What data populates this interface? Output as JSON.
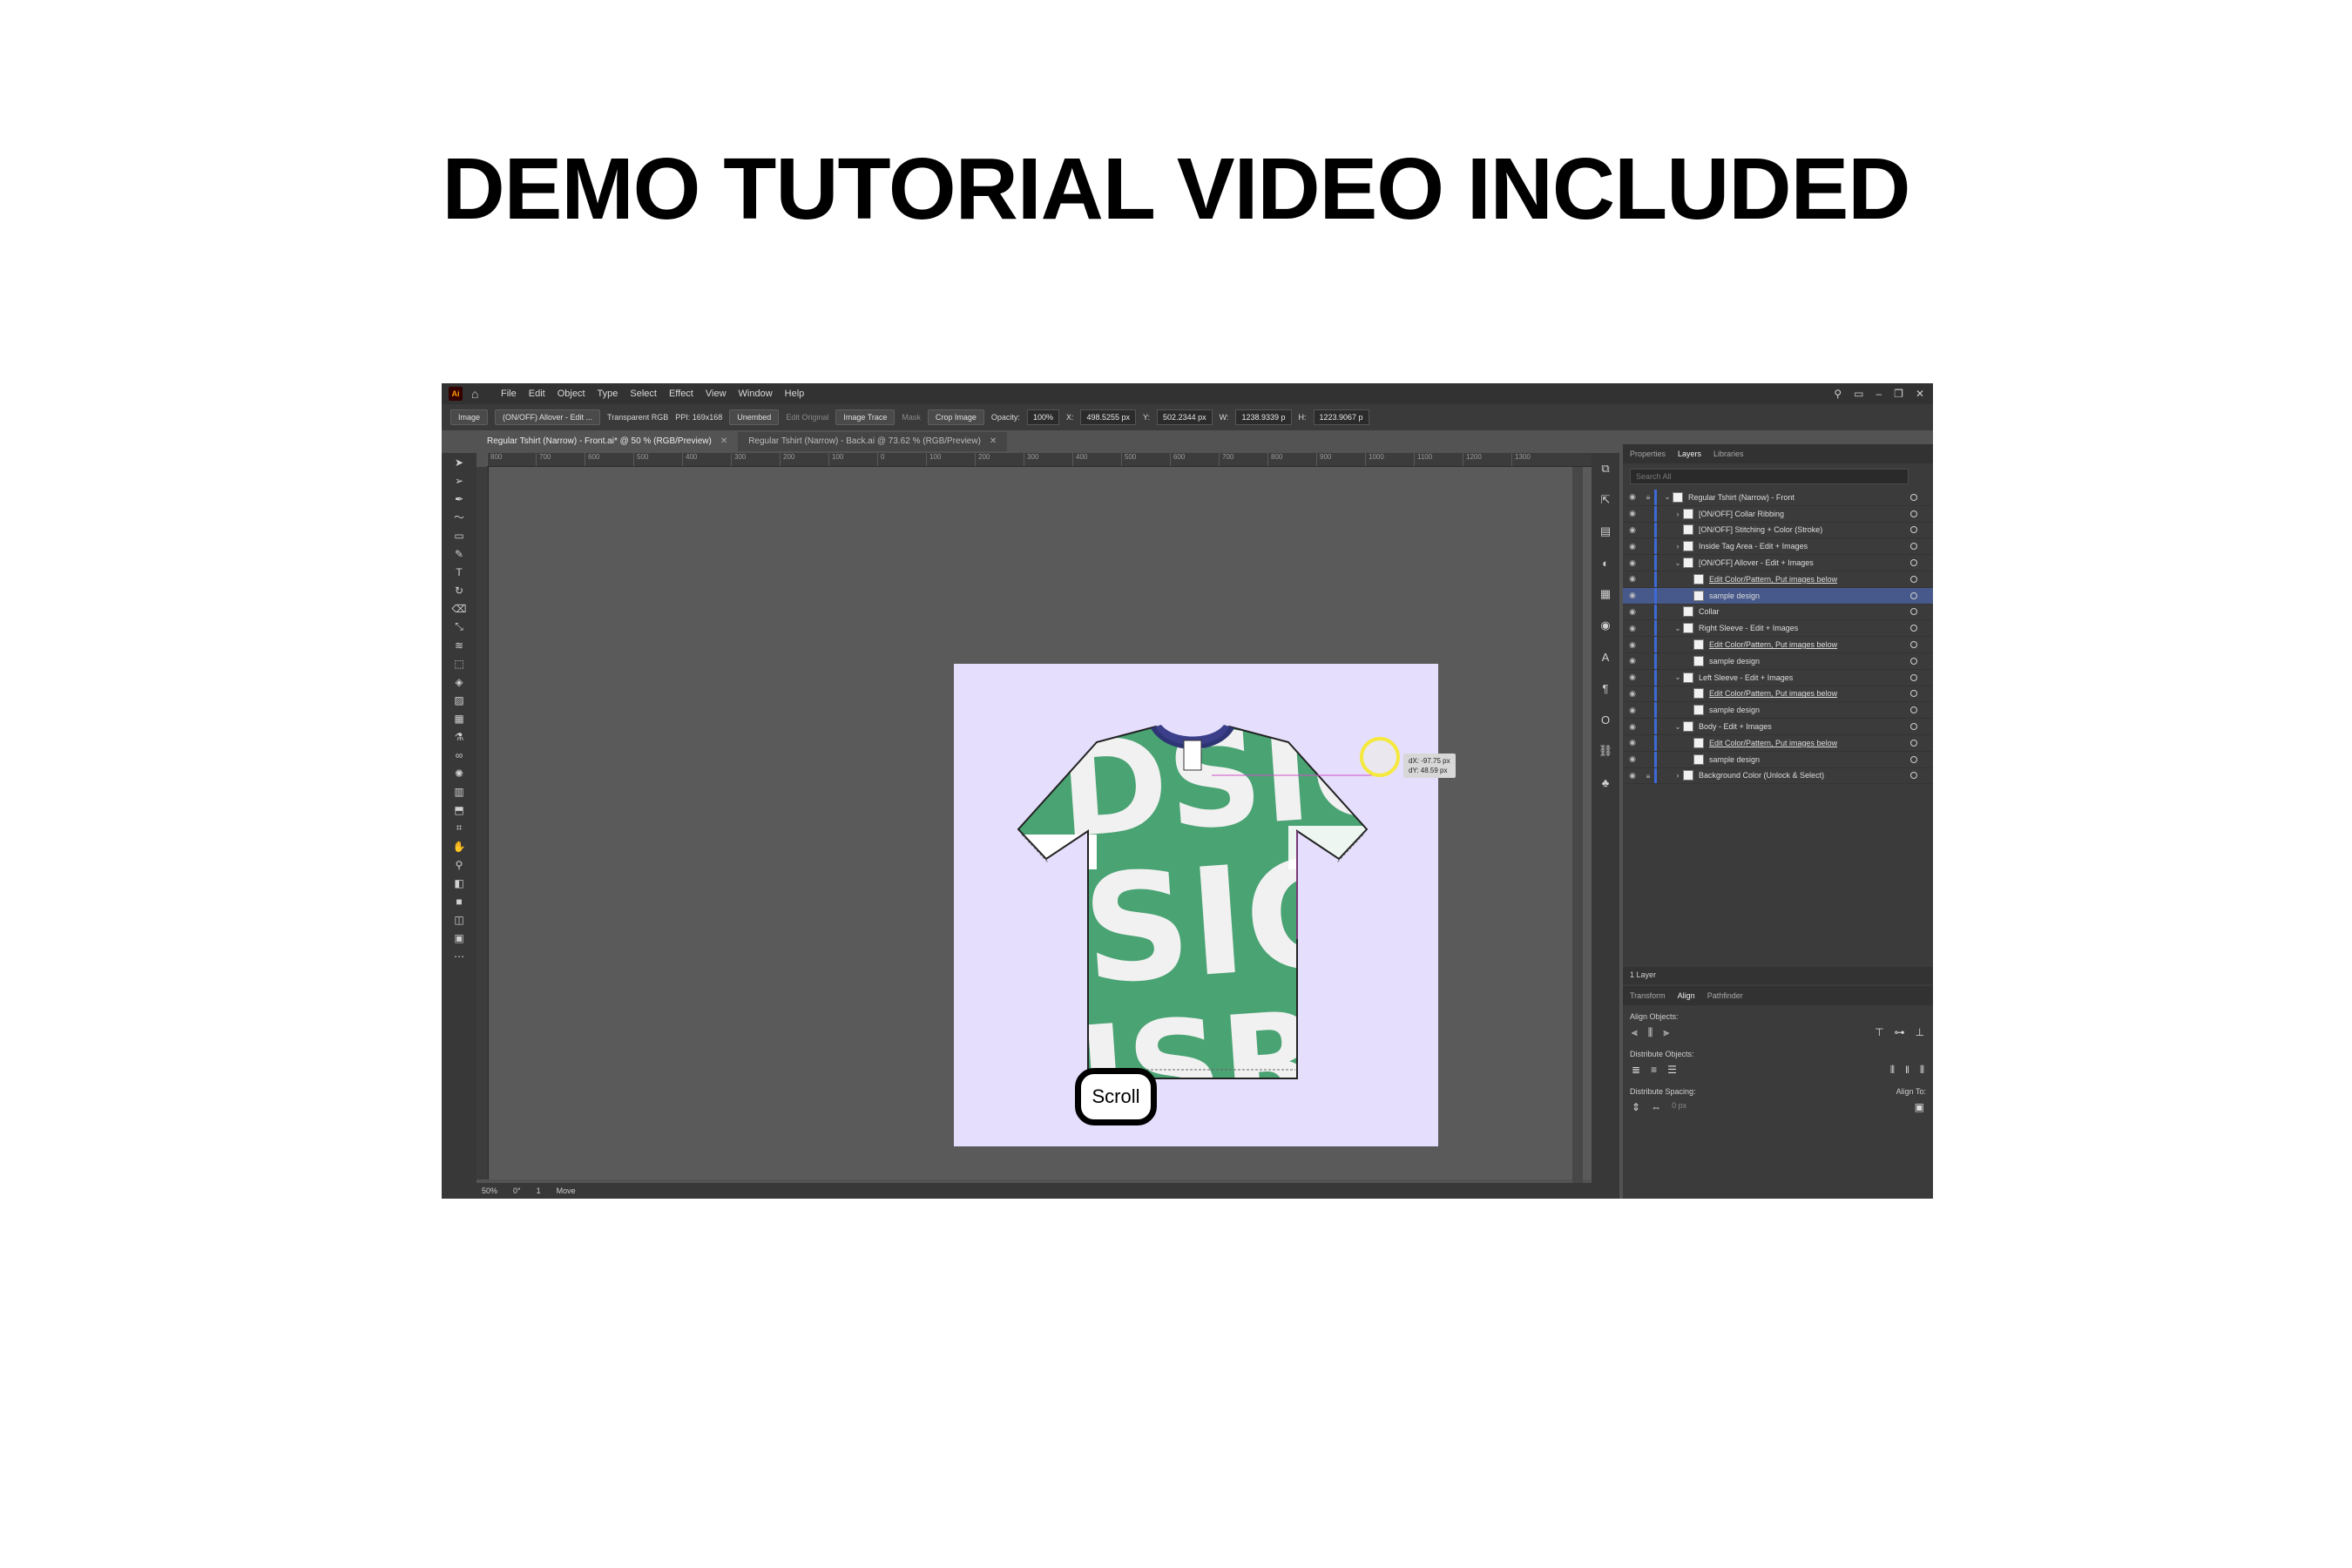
{
  "headline": "DEMO TUTORIAL VIDEO INCLUDED",
  "app": {
    "logo": "Ai",
    "menu": [
      "File",
      "Edit",
      "Object",
      "Type",
      "Select",
      "Effect",
      "View",
      "Window",
      "Help"
    ]
  },
  "control_bar": {
    "selection_type": "Image",
    "linked_file": "(ON/OFF) Allover - Edit ...",
    "color_mode": "Transparent RGB",
    "ppi": "PPI: 169x168",
    "unembed": "Unembed",
    "edit_original": "Edit Original",
    "image_trace": "Image Trace",
    "mask": "Mask",
    "crop_image": "Crop Image",
    "opacity_label": "Opacity:",
    "opacity_value": "100%",
    "x_label": "X:",
    "x_value": "498.5255 px",
    "y_label": "Y:",
    "y_value": "502.2344 px",
    "w_label": "W:",
    "w_value": "1238.9339 p",
    "h_label": "H:",
    "h_value": "1223.9067 p"
  },
  "tabs": [
    {
      "label": "Regular Tshirt (Narrow) - Front.ai* @ 50 % (RGB/Preview)"
    },
    {
      "label": "Regular Tshirt (Narrow) - Back.ai @ 73.62 % (RGB/Preview)"
    }
  ],
  "ruler_ticks": [
    "800",
    "700",
    "600",
    "500",
    "400",
    "300",
    "200",
    "100",
    "0",
    "100",
    "200",
    "300",
    "400",
    "500",
    "600",
    "700",
    "800",
    "900",
    "1000",
    "1100",
    "1200",
    "1300"
  ],
  "tooltip": {
    "dx": "dX: -97.75 px",
    "dy": "dY: 48.59 px"
  },
  "scroll_label": "Scroll",
  "status": {
    "zoom": "50%",
    "rotation": "0°",
    "artboard": "1",
    "tool": "Move"
  },
  "panel": {
    "tabs": [
      "Properties",
      "Layers",
      "Libraries"
    ],
    "search_placeholder": "Search All",
    "layers": [
      {
        "name": "Regular Tshirt (Narrow) - Front",
        "indent": 0,
        "expanded": true
      },
      {
        "name": "[ON/OFF] Collar Ribbing",
        "indent": 1,
        "expanded": false
      },
      {
        "name": "[ON/OFF] Stitching + Color (Stroke)",
        "indent": 1
      },
      {
        "name": "Inside Tag Area - Edit + Images",
        "indent": 1,
        "expanded": false
      },
      {
        "name": "[ON/OFF] Allover - Edit + Images",
        "indent": 1,
        "expanded": true
      },
      {
        "name": "Edit Color/Pattern, Put images below",
        "indent": 2,
        "link": true
      },
      {
        "name": "sample design",
        "indent": 2,
        "selected": true
      },
      {
        "name": "Collar",
        "indent": 1
      },
      {
        "name": "Right Sleeve - Edit + Images",
        "indent": 1,
        "expanded": true
      },
      {
        "name": "Edit Color/Pattern, Put images below",
        "indent": 2,
        "link": true
      },
      {
        "name": "sample design",
        "indent": 2
      },
      {
        "name": "Left Sleeve - Edit + Images",
        "indent": 1,
        "expanded": true
      },
      {
        "name": "Edit Color/Pattern, Put images below",
        "indent": 2,
        "link": true
      },
      {
        "name": "sample design",
        "indent": 2
      },
      {
        "name": "Body - Edit + Images",
        "indent": 1,
        "expanded": true
      },
      {
        "name": "Edit Color/Pattern, Put images below",
        "indent": 2,
        "link": true
      },
      {
        "name": "sample design",
        "indent": 2
      },
      {
        "name": "Background Color (Unlock & Select)",
        "indent": 1,
        "expanded": false
      }
    ],
    "layer_count": "1 Layer",
    "align_tabs": [
      "Transform",
      "Align",
      "Pathfinder"
    ],
    "align_objects": "Align Objects:",
    "distribute_objects": "Distribute Objects:",
    "distribute_spacing": "Distribute Spacing:",
    "align_to": "Align To:",
    "spacing_value": "0 px"
  },
  "colors": {
    "accent": "#3d6ad6",
    "shirt_green": "#4aa373",
    "artboard": "#e5dffd"
  }
}
